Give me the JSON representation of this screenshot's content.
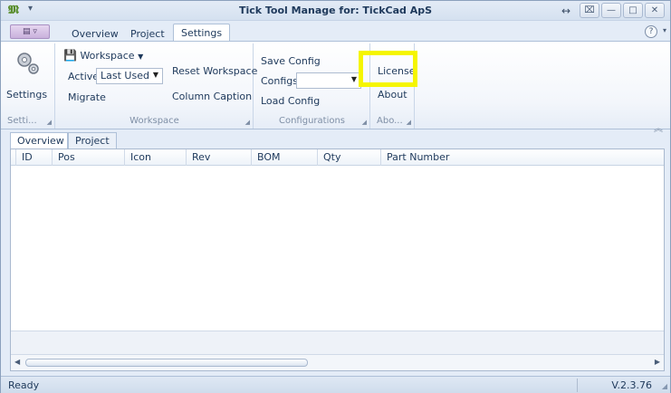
{
  "window": {
    "title": "Tick Tool Manage for: TickCad ApS"
  },
  "tabs": [
    {
      "label": "Overview"
    },
    {
      "label": "Project"
    },
    {
      "label": "Settings"
    }
  ],
  "ribbon": {
    "settings_group": {
      "button": "Settings",
      "caption": "Setti..."
    },
    "workspace_group": {
      "workspace_dropdown": "Workspace",
      "active_label": "Active",
      "active_value": "Last Used",
      "migrate": "Migrate",
      "reset_workspace": "Reset Workspace",
      "column_caption": "Column Caption",
      "caption": "Workspace"
    },
    "configurations_group": {
      "save_config": "Save Config",
      "configs_label": "Configs",
      "configs_value": "",
      "load_config": "Load Config",
      "caption": "Configurations"
    },
    "about_group": {
      "license": "License",
      "about": "About",
      "caption": "Abo..."
    }
  },
  "doc_tabs": [
    {
      "label": "Overview"
    },
    {
      "label": "Project"
    }
  ],
  "grid": {
    "columns": [
      "ID",
      "Pos",
      "Icon",
      "Rev",
      "BOM",
      "Qty",
      "Part Number"
    ]
  },
  "status": {
    "text": "Ready",
    "version": "V.2.3.76"
  },
  "colors": {
    "highlight": "#f5f500",
    "accent": "#1e395b"
  }
}
